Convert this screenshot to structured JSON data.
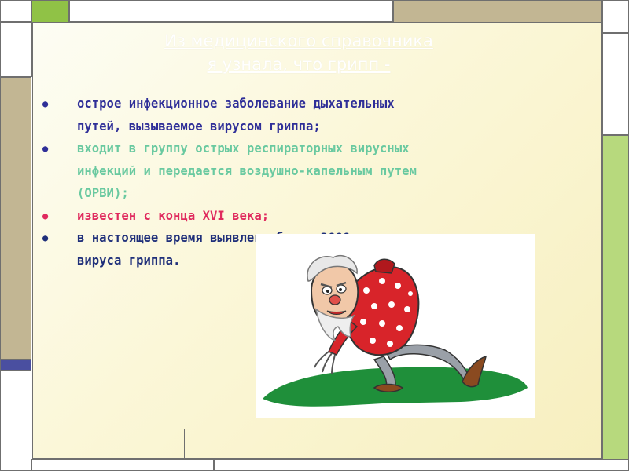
{
  "slide": {
    "title_lines": [
      "Из медицинского справочника",
      "я узнала, что грипп -"
    ],
    "colors": {
      "title": "#ffffff",
      "panel_background": "#fbf7d8",
      "olive_block": "#90c246",
      "tan_block": "#c2b693",
      "slate_block": "#4a4fa0",
      "green_block": "#b7d97d"
    },
    "bullets": [
      {
        "lines": [
          "острое инфекционное заболевание дыхательных",
          "путей, вызываемое вирусом гриппа;"
        ],
        "color": "#2f2f98",
        "bullet_color": "#2f2f98"
      },
      {
        "lines": [
          "входит в группу острых респираторных вирусных",
          "инфекций и передается воздушно-капельным путем",
          "(ОРВИ);"
        ],
        "color": "#69c9a0",
        "bullet_color": "#2f2f98"
      },
      {
        "lines": [
          "известен с конца XVI века;"
        ],
        "color": "#e02a5e",
        "bullet_color": "#e02a5e"
      },
      {
        "lines": [
          "в настоящее время выявлено более 2000 вариантов",
          "вируса гриппа."
        ],
        "color": "#1f2f7a",
        "bullet_color": "#1f2f7a"
      }
    ],
    "illustration": "sick-old-man-cartoon"
  }
}
